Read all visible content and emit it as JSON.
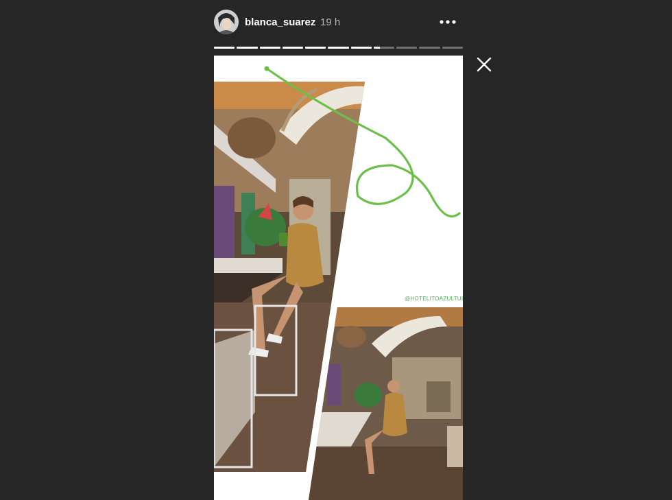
{
  "header": {
    "username": "blanca_suarez",
    "timestamp": "19 h"
  },
  "progress": {
    "segment_fill": [
      1,
      1,
      1,
      1,
      1,
      1,
      1,
      0.3,
      0,
      0,
      0
    ]
  },
  "story": {
    "mention": "@HOTELITOAZULTULUM",
    "scribble_color": "#6cc04a"
  },
  "icons": {
    "more": "more-icon",
    "close": "close-icon"
  }
}
